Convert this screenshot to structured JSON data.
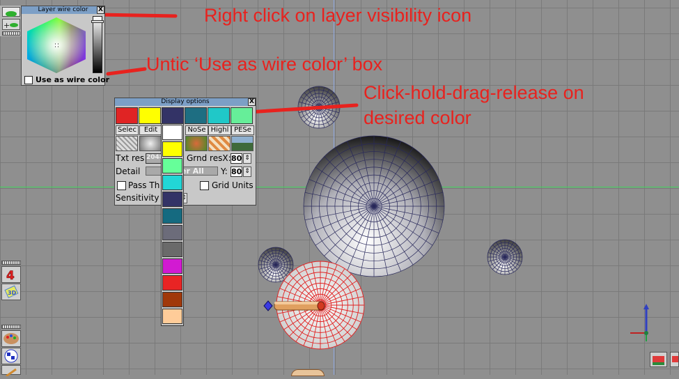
{
  "layer_wire_panel": {
    "title": "Layer wire color",
    "close": "X",
    "use_as_wire_label": "Use as wire color",
    "use_as_wire_checked": false
  },
  "display_options": {
    "title": "Display options",
    "close": "X",
    "top_colors": [
      "#e02424",
      "#ffff00",
      "#333366",
      "#1e6e82",
      "#20c8c8",
      "#66ee99"
    ],
    "buttons": [
      "Selec",
      "Edit",
      "NoSe",
      "Highl",
      "PESe"
    ],
    "txt_res_label": "Txt res",
    "txt_res_value": "2048",
    "grnd_res_label": "Grnd resX:",
    "grnd_x_value": "80",
    "detail_label": "Detail",
    "detail_value": "er All",
    "y_label": "Y:",
    "grnd_y_value": "80",
    "pass_label": "Pass Th",
    "grid_units_label": "Grid Units",
    "sensitivity_label": "Sensitivity"
  },
  "color_dropdown": {
    "colors": [
      "#ffffff",
      "#ffff00",
      "#66ff99",
      "#22d6d6",
      "#333366",
      "#156a80",
      "#6c6c7a",
      "#6a6a6a",
      "#d21ad2",
      "#e82424",
      "#a0380a",
      "#ffcc99"
    ]
  },
  "annotations": {
    "a1": "Right click on layer visibility icon",
    "a2": "Untic ‘Use as wire color’ box",
    "a3_line1": "Click-hold-drag-release on",
    "a3_line2": "desired color"
  },
  "colors": {
    "annotation": "#e8221e",
    "title_bar": "#7c9fc6",
    "viewport": "#8f8f8f",
    "wire_blue": "#28285a",
    "wire_red": "#e02020"
  }
}
